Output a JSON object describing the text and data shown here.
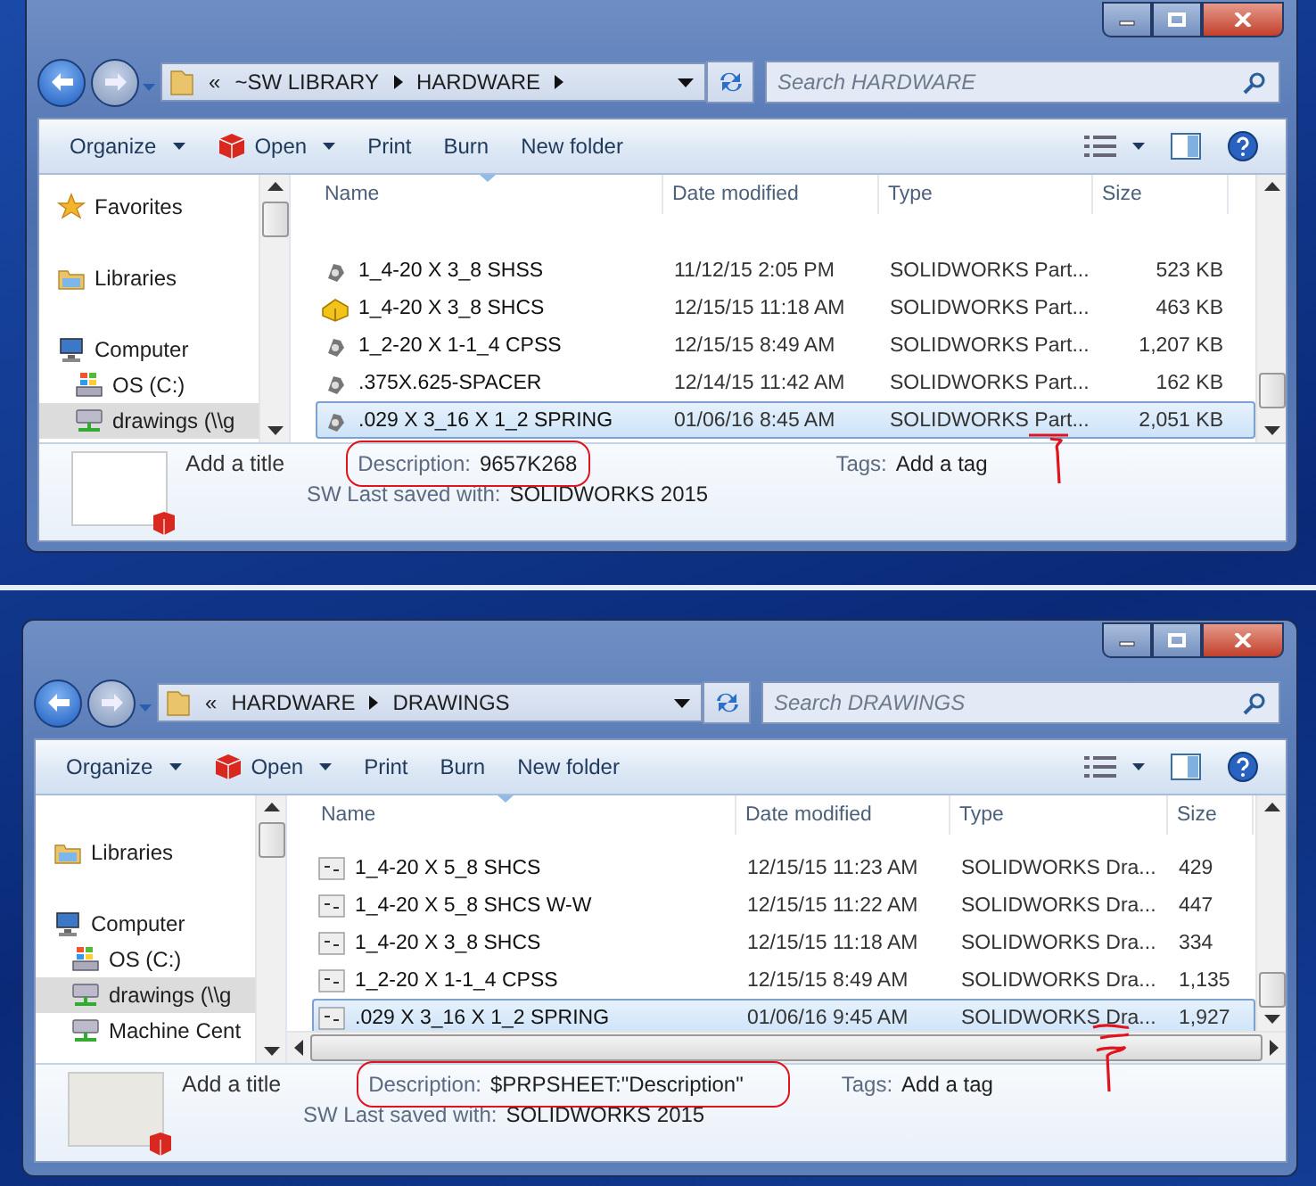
{
  "windows": [
    {
      "address": {
        "overflow": "«",
        "segments": [
          {
            "label": "~SW LIBRARY",
            "arrow": true
          },
          {
            "label": "HARDWARE",
            "arrow": true
          }
        ]
      },
      "search": {
        "placeholder": "Search HARDWARE"
      },
      "toolbar": [
        {
          "label": "Organize",
          "kind": "menu"
        },
        {
          "label": "Open",
          "kind": "app-menu"
        },
        {
          "label": "Print",
          "kind": "plain"
        },
        {
          "label": "Burn",
          "kind": "plain"
        },
        {
          "label": "New folder",
          "kind": "plain"
        }
      ],
      "sidebar": {
        "items": [
          {
            "label": "Favorites",
            "kind": "favorites",
            "selected": false
          },
          {
            "label": "Libraries",
            "kind": "libraries",
            "selected": false
          },
          {
            "label": "Computer",
            "kind": "computer",
            "selected": false,
            "children": [
              {
                "label": "OS (C:)",
                "kind": "drive",
                "selected": false
              },
              {
                "label": "drawings (\\\\g",
                "kind": "network",
                "selected": true
              }
            ]
          }
        ]
      },
      "table": {
        "columns": [
          "Name",
          "Date modified",
          "Type",
          "Size"
        ],
        "rows": [
          {
            "kind": "part",
            "name": "1_4-20 X 3_8 SHSS",
            "date": "11/12/15 2:05 PM",
            "type": "SOLIDWORKS Part...",
            "size": "523 KB",
            "selected": false
          },
          {
            "kind": "part-yellow",
            "name": "1_4-20 X 3_8 SHCS",
            "date": "12/15/15 11:18 AM",
            "type": "SOLIDWORKS Part...",
            "size": "463 KB",
            "selected": false
          },
          {
            "kind": "part",
            "name": "1_2-20 X 1-1_4 CPSS",
            "date": "12/15/15 8:49 AM",
            "type": "SOLIDWORKS Part...",
            "size": "1,207 KB",
            "selected": false
          },
          {
            "kind": "part",
            "name": ".375X.625-SPACER",
            "date": "12/14/15 11:42 AM",
            "type": "SOLIDWORKS Part...",
            "size": "162 KB",
            "selected": false
          },
          {
            "kind": "part",
            "name": ".029 X 3_16 X 1_2 SPRING",
            "date": "01/06/16 8:45 AM",
            "type": "SOLIDWORKS Part...",
            "size": "2,051 KB",
            "selected": true
          }
        ]
      },
      "details": {
        "thumbnail": {
          "kind": "part"
        },
        "title": "Add a title",
        "description_label": "Description:",
        "description": "9657K268",
        "tags_label": "Tags:",
        "tags": "Add a tag",
        "saved_label": "SW Last saved with:",
        "saved_with": "SOLIDWORKS 2015"
      }
    },
    {
      "address": {
        "overflow": "«",
        "segments": [
          {
            "label": "HARDWARE",
            "arrow": true
          },
          {
            "label": "DRAWINGS",
            "arrow": false
          }
        ]
      },
      "search": {
        "placeholder": "Search DRAWINGS"
      },
      "toolbar": [
        {
          "label": "Organize",
          "kind": "menu"
        },
        {
          "label": "Open",
          "kind": "app-menu"
        },
        {
          "label": "Print",
          "kind": "plain"
        },
        {
          "label": "Burn",
          "kind": "plain"
        },
        {
          "label": "New folder",
          "kind": "plain"
        }
      ],
      "sidebar": {
        "items": [
          {
            "label": "Libraries",
            "kind": "libraries",
            "selected": false
          },
          {
            "label": "Computer",
            "kind": "computer",
            "selected": false,
            "children": [
              {
                "label": "OS (C:)",
                "kind": "drive",
                "selected": false
              },
              {
                "label": "drawings (\\\\g",
                "kind": "network",
                "selected": true
              },
              {
                "label": "Machine Cent",
                "kind": "network",
                "selected": false
              }
            ]
          }
        ]
      },
      "table": {
        "columns": [
          "Name",
          "Date modified",
          "Type",
          "Size"
        ],
        "rows": [
          {
            "kind": "drawing",
            "name": "1_4-20 X 5_8 SHCS",
            "date": "12/15/15 11:23 AM",
            "type": "SOLIDWORKS Dra...",
            "size": "429",
            "selected": false
          },
          {
            "kind": "drawing",
            "name": "1_4-20 X 5_8 SHCS W-W",
            "date": "12/15/15 11:22 AM",
            "type": "SOLIDWORKS Dra...",
            "size": "447",
            "selected": false
          },
          {
            "kind": "drawing",
            "name": "1_4-20 X 3_8 SHCS",
            "date": "12/15/15 11:18 AM",
            "type": "SOLIDWORKS Dra...",
            "size": "334",
            "selected": false
          },
          {
            "kind": "drawing",
            "name": "1_2-20 X 1-1_4 CPSS",
            "date": "12/15/15 8:49 AM",
            "type": "SOLIDWORKS Dra...",
            "size": "1,135",
            "selected": false
          },
          {
            "kind": "drawing",
            "name": ".029 X 3_16 X 1_2 SPRING",
            "date": "01/06/16 9:45 AM",
            "type": "SOLIDWORKS Dra...",
            "size": "1,927",
            "selected": true
          }
        ]
      },
      "details": {
        "thumbnail": {
          "kind": "drawing"
        },
        "title": "Add a title",
        "description_label": "Description:",
        "description": "$PRPSHEET:\"Description\"",
        "tags_label": "Tags:",
        "tags": "Add a tag",
        "saved_label": "SW Last saved with:",
        "saved_with": "SOLIDWORKS 2015"
      }
    }
  ]
}
